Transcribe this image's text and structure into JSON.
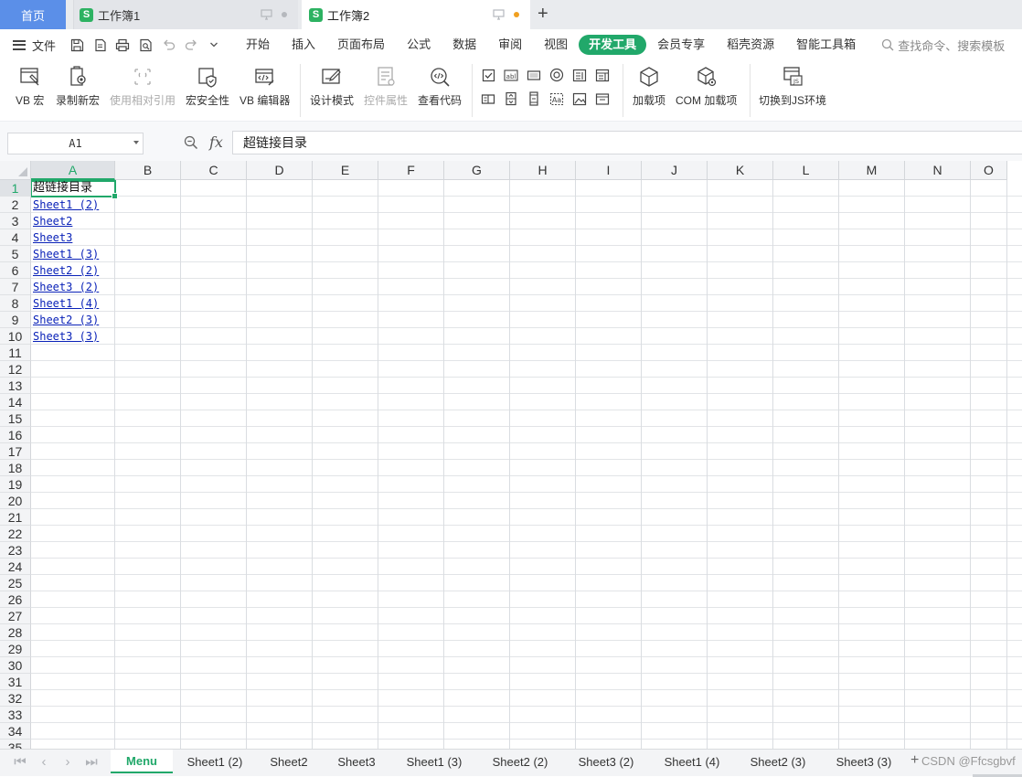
{
  "tabs": {
    "home": "首页",
    "docs": [
      {
        "title": "工作簿1",
        "logo": "S",
        "dirty": false
      },
      {
        "title": "工作簿2",
        "logo": "S",
        "dirty": true
      }
    ],
    "new_tab_symbol": "+"
  },
  "menu": {
    "file_label": "文件",
    "items": [
      "开始",
      "插入",
      "页面布局",
      "公式",
      "数据",
      "审阅",
      "视图",
      "开发工具",
      "会员专享",
      "稻壳资源",
      "智能工具箱"
    ],
    "active_item": "开发工具",
    "search_placeholder": "查找命令、搜索模板"
  },
  "ribbon": {
    "vb_macro": "VB 宏",
    "record_macro": "录制新宏",
    "relative_ref": "使用相对引用",
    "macro_security": "宏安全性",
    "vb_editor": "VB 编辑器",
    "design_mode": "设计模式",
    "control_props": "控件属性",
    "view_code": "查看代码",
    "addins": "加载项",
    "com_addins": "COM 加载项",
    "switch_js": "切换到JS环境"
  },
  "formula_bar": {
    "name_box": "A1",
    "fx_label": "fx",
    "formula": "超链接目录"
  },
  "grid": {
    "columns": [
      "A",
      "B",
      "C",
      "D",
      "E",
      "F",
      "G",
      "H",
      "I",
      "J",
      "K",
      "L",
      "M",
      "N",
      "O"
    ],
    "selected_column": "A",
    "rows": [
      1,
      2,
      3,
      4,
      5,
      6,
      7,
      8,
      9,
      10,
      11,
      12,
      13,
      14,
      15,
      16,
      17,
      18,
      19,
      20,
      21,
      22,
      23,
      24,
      25,
      26,
      27,
      28,
      29,
      30,
      31,
      32,
      33,
      34,
      35
    ],
    "selected_row": 1,
    "cells_a": [
      {
        "row": 1,
        "text": "超链接目录",
        "link": false
      },
      {
        "row": 2,
        "text": "Sheet1 (2)",
        "link": true
      },
      {
        "row": 3,
        "text": "Sheet2",
        "link": true
      },
      {
        "row": 4,
        "text": "Sheet3",
        "link": true
      },
      {
        "row": 5,
        "text": "Sheet1 (3)",
        "link": true
      },
      {
        "row": 6,
        "text": "Sheet2 (2)",
        "link": true
      },
      {
        "row": 7,
        "text": "Sheet3 (2)",
        "link": true
      },
      {
        "row": 8,
        "text": "Sheet1 (4)",
        "link": true
      },
      {
        "row": 9,
        "text": "Sheet2 (3)",
        "link": true
      },
      {
        "row": 10,
        "text": "Sheet3 (3)",
        "link": true
      }
    ]
  },
  "sheets": {
    "tabs": [
      "Menu",
      "Sheet1 (2)",
      "Sheet2",
      "Sheet3",
      "Sheet1 (3)",
      "Sheet2 (2)",
      "Sheet3 (2)",
      "Sheet1 (4)",
      "Sheet2 (3)",
      "Sheet3 (3)"
    ],
    "active": "Menu",
    "add_symbol": "+",
    "watermark": "CSDN @Ffcsgbvf"
  },
  "colors": {
    "accent": "#21a86a",
    "home_tab": "#5b8fe8",
    "link": "#0a22b8",
    "dirty_dot": "#f0a020"
  }
}
